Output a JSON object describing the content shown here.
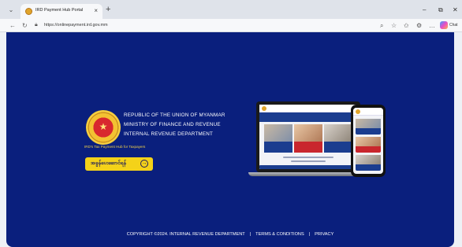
{
  "browser": {
    "tab_title": "IRD Payment Hub Portal",
    "tab_close": "×",
    "new_tab": "+",
    "url": "https://onlinepayment.ird.gov.mm",
    "chat_label": "Chat",
    "window_controls": {
      "minimize": "–",
      "restore": "⧉",
      "close": "✕"
    },
    "icons": [
      "back-icon",
      "refresh-icon",
      "lock-icon",
      "zoom-icon",
      "favorite-icon",
      "collections-icon",
      "extensions-icon",
      "more-icon",
      "copilot-icon"
    ]
  },
  "page": {
    "background": "#0a1f7d",
    "gov_lines": [
      "REPUBLIC OF THE UNION OF MYANMAR",
      "MINISTRY OF FINANCE AND REVENUE",
      "INTERNAL REVENUE DEPARTMENT"
    ],
    "hub_caption": "IRD's Tax Payment Hub for Taxpayers",
    "cta_label": "အခွန်ပေးဆောင်ရန်",
    "cta_color": "#f4d219",
    "footer": {
      "copyright": "COPYRIGHT ©2024. INTERNAL REVENUE DEPARTMENT",
      "separator": "|",
      "terms": "TERMS & CONDITIONS",
      "privacy": "PRIVACY"
    }
  }
}
